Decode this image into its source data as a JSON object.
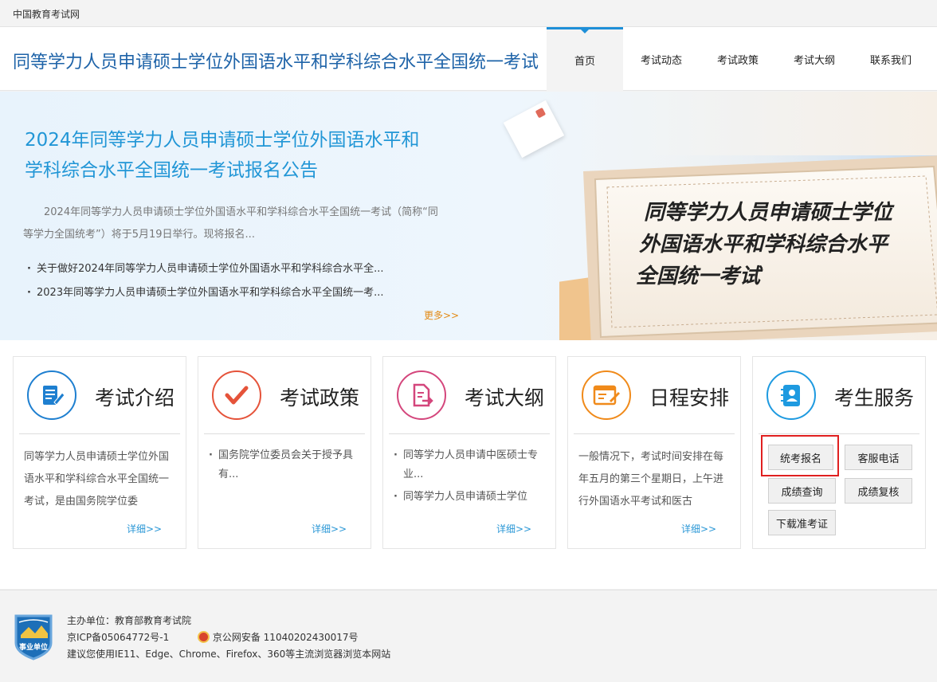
{
  "topbar": {
    "site_name": "中国教育考试网"
  },
  "header": {
    "title": "同等学力人员申请硕士学位外国语水平和学科综合水平全国统一考试",
    "nav": [
      {
        "label": "首页",
        "active": true
      },
      {
        "label": "考试动态"
      },
      {
        "label": "考试政策"
      },
      {
        "label": "考试大纲"
      },
      {
        "label": "联系我们"
      }
    ]
  },
  "banner": {
    "headline_line1": "2024年同等学力人员申请硕士学位外国语水平和",
    "headline_line2": "学科综合水平全国统一考试报名公告",
    "intro": "2024年同等学力人员申请硕士学位外国语水平和学科综合水平全国统一考试（简称“同等学力全国统考”）将于5月19日举行。现将报名...",
    "links": [
      "关于做好2024年同等学力人员申请硕士学位外国语水平和学科综合水平全...",
      "2023年同等学力人员申请硕士学位外国语水平和学科综合水平全国统一考..."
    ],
    "more": "更多>>",
    "board_line1": "同等学力人员申请硕士学位",
    "board_line2": "外国语水平和学科综合水平",
    "board_line3": "全国统一考试"
  },
  "cards": {
    "intro": {
      "title": "考试介绍",
      "text": "同等学力人员申请硕士学位外国语水平和学科综合水平全国统一考试，是由国务院学位委",
      "detail": "详细>>"
    },
    "policy": {
      "title": "考试政策",
      "items": [
        "国务院学位委员会关于授予具有..."
      ],
      "detail": "详细>>"
    },
    "syllabus": {
      "title": "考试大纲",
      "items": [
        "同等学力人员申请中医硕士专业...",
        "同等学力人员申请硕士学位"
      ],
      "detail": "详细>>"
    },
    "schedule": {
      "title": "日程安排",
      "text": "一般情况下，考试时间安排在每年五月的第三个星期日，上午进行外国语水平考试和医古",
      "detail": "详细>>"
    },
    "service": {
      "title": "考生服务",
      "buttons": {
        "register": "统考报名",
        "hotline": "客服电话",
        "score_query": "成绩查询",
        "score_review": "成绩复核",
        "admit_card": "下载准考证"
      }
    }
  },
  "footer": {
    "organizer": "主办单位：教育部教育考试院",
    "icp": "京ICP备05064772号-1",
    "police": "京公网安备 11040202430017号",
    "browser": "建议您使用IE11、Edge、Chrome、Firefox、360等主流浏览器浏览本网站",
    "badge_text": "事业单位"
  },
  "colors": {
    "brand_blue": "#1e63a8",
    "accent_blue": "#2196d6",
    "orange": "#e38a14",
    "highlight_red": "#e02020"
  }
}
